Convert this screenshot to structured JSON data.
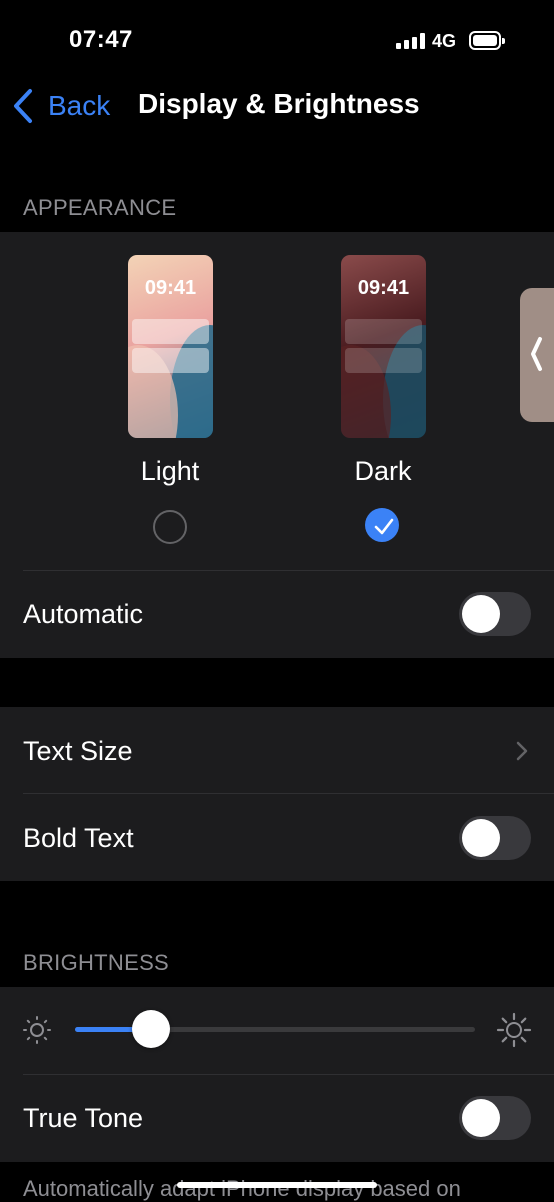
{
  "status_bar": {
    "time": "07:47",
    "network": "4G"
  },
  "nav": {
    "back_label": "Back",
    "title": "Display & Brightness"
  },
  "appearance": {
    "section_label": "APPEARANCE",
    "light": {
      "preview_time": "09:41",
      "label": "Light",
      "selected": false
    },
    "dark": {
      "preview_time": "09:41",
      "label": "Dark",
      "selected": true
    },
    "automatic": {
      "label": "Automatic",
      "on": false
    }
  },
  "text": {
    "text_size_label": "Text Size",
    "bold_text": {
      "label": "Bold Text",
      "on": false
    }
  },
  "brightness": {
    "section_label": "BRIGHTNESS",
    "level": 0.19,
    "true_tone": {
      "label": "True Tone",
      "on": false
    },
    "footer": "Automatically adapt iPhone display based on"
  },
  "colors": {
    "accent": "#3b82f6",
    "group_bg": "#1c1c1e",
    "background": "#000000"
  },
  "icons": [
    "chevron-left-icon",
    "chevron-right-icon",
    "sun-small-icon",
    "sun-large-icon",
    "checkmark-icon"
  ]
}
